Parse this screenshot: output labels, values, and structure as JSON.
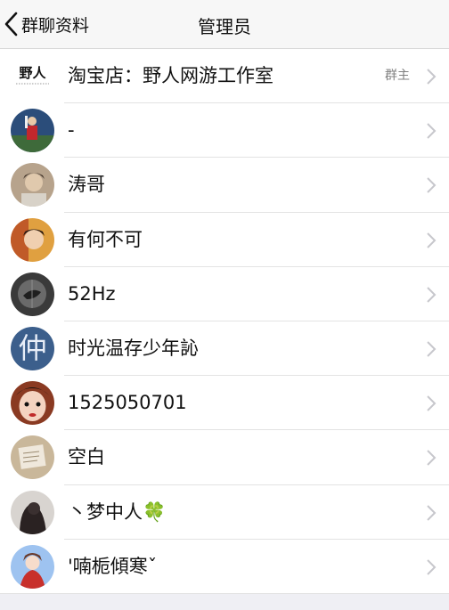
{
  "nav": {
    "back_label": "群聊资料",
    "title": "管理员"
  },
  "members": [
    {
      "name": "淘宝店：野人网游工作室",
      "badge": "群主",
      "avatar_icon": "wild-man-logo",
      "avatar_text": "野人",
      "color": "#ffffff"
    },
    {
      "name": "-",
      "avatar_icon": "stadium-photo",
      "color": "#2b4d7a"
    },
    {
      "name": "涛哥",
      "avatar_icon": "portrait-photo",
      "color": "#b7a38c"
    },
    {
      "name": "有何不可",
      "avatar_icon": "portrait-photo",
      "color": "#d08040"
    },
    {
      "name": "52Hz",
      "avatar_icon": "whale-photo",
      "color": "#3a3a3a"
    },
    {
      "name": "时光温存少年訫",
      "avatar_icon": "character-photo",
      "avatar_text": "仲",
      "color": "#3c5f8c"
    },
    {
      "name": "1525050701",
      "avatar_icon": "opera-face-photo",
      "color": "#8a3a22"
    },
    {
      "name": "空白",
      "avatar_icon": "book-photo",
      "color": "#c9b79a"
    },
    {
      "name": "丶梦中人🍀",
      "avatar_icon": "dark-portrait-photo",
      "color": "#2a2222"
    },
    {
      "name": "'喃栀傾寒ˇ",
      "avatar_icon": "anime-girl-photo",
      "color": "#6a8fd0"
    }
  ]
}
